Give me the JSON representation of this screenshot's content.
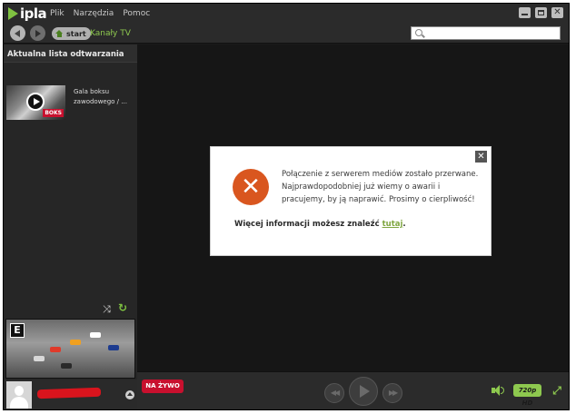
{
  "app": {
    "logo_text": "ipla",
    "menu": [
      "Plik",
      "Narzędzia",
      "Pomoc"
    ],
    "window_controls": [
      "minimize-icon",
      "maximize-icon",
      "close-icon"
    ],
    "close_glyph": "✕"
  },
  "nav": {
    "start_label": "start",
    "breadcrumb": "Kanały TV",
    "search_value": "",
    "search_placeholder": ""
  },
  "sidebar": {
    "title": "Aktualna lista odtwarzania",
    "items": [
      {
        "title": "Gala boksu zawodowego / ...",
        "thumb_tag": "BOKS"
      }
    ],
    "preview_badge": "E"
  },
  "dialog": {
    "close_glyph": "✕",
    "error_glyph": "✕",
    "message": "Połączenie z serwerem mediów zostało przerwane. Najprawdopodobniej już wiemy o awarii i pracujemy, by ją naprawić. Prosimy o cierpliwość!",
    "more_prefix": "Więcej informacji możesz znaleźć ",
    "more_link": "tutaj",
    "more_suffix": "."
  },
  "player": {
    "live_label": "NA ŻYWO",
    "quality_label": "720p HD"
  },
  "colors": {
    "accent_green": "#8ec94f",
    "live_red": "#c8102e",
    "error_orange": "#d9561f"
  }
}
